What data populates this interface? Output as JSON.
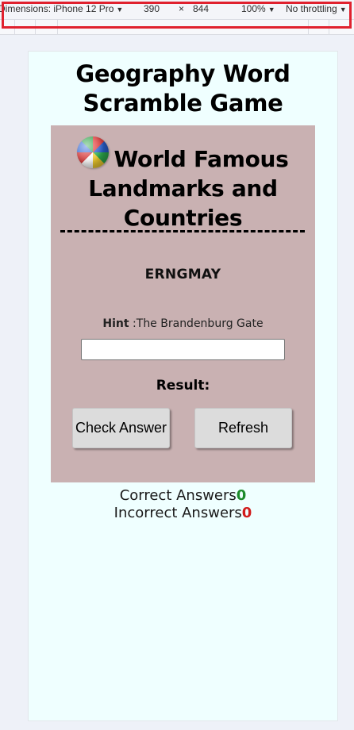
{
  "devtools": {
    "dimensions_label": "Dimensions: iPhone 12 Pro",
    "width": "390",
    "times": "×",
    "height": "844",
    "zoom": "100%",
    "throttling": "No throttling"
  },
  "page": {
    "title": "Geography Word Scramble Game"
  },
  "game": {
    "heading": "World Famous Landmarks and Countries",
    "scrambled_word": "ERNGMAY",
    "hint_label": "Hint",
    "hint_text": " :The Brandenburg Gate",
    "answer_value": "",
    "result_label": "Result:",
    "check_button": "Check Answer",
    "refresh_button": "Refresh"
  },
  "score": {
    "correct_label": "Correct Answers",
    "correct_count": "0",
    "incorrect_label": "Incorrect Answers",
    "incorrect_count": "0"
  },
  "colors": {
    "page_background": "#efffff",
    "card_background": "#c9b1b2",
    "correct": "#1c8a2a",
    "incorrect": "#d11c1c",
    "highlight": "#e0212e"
  }
}
